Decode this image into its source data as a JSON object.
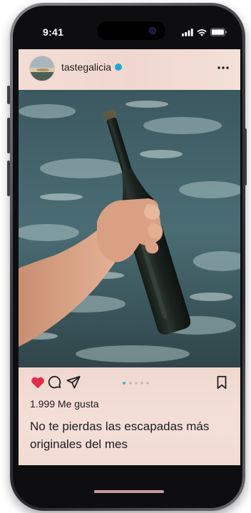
{
  "status_bar": {
    "time": "9:41",
    "icons": [
      "signal-icon",
      "wifi-icon",
      "battery-icon"
    ]
  },
  "post": {
    "username": "tastegalicia",
    "verified": true,
    "more_icon": "more-icon",
    "image": "hand-holding-bottle-in-sea",
    "actions": [
      "heart-icon",
      "comment-icon",
      "share-icon",
      "bookmark-icon"
    ],
    "liked": true,
    "likes_text": "1.999 Me gusta",
    "caption": "No te pierdas las escapadas más originales del mes"
  },
  "colors": {
    "post_background": "#f3dcd4",
    "heart": "#e0314a",
    "verified_badge": "#1fa9d8",
    "text": "#1d1d1f"
  }
}
